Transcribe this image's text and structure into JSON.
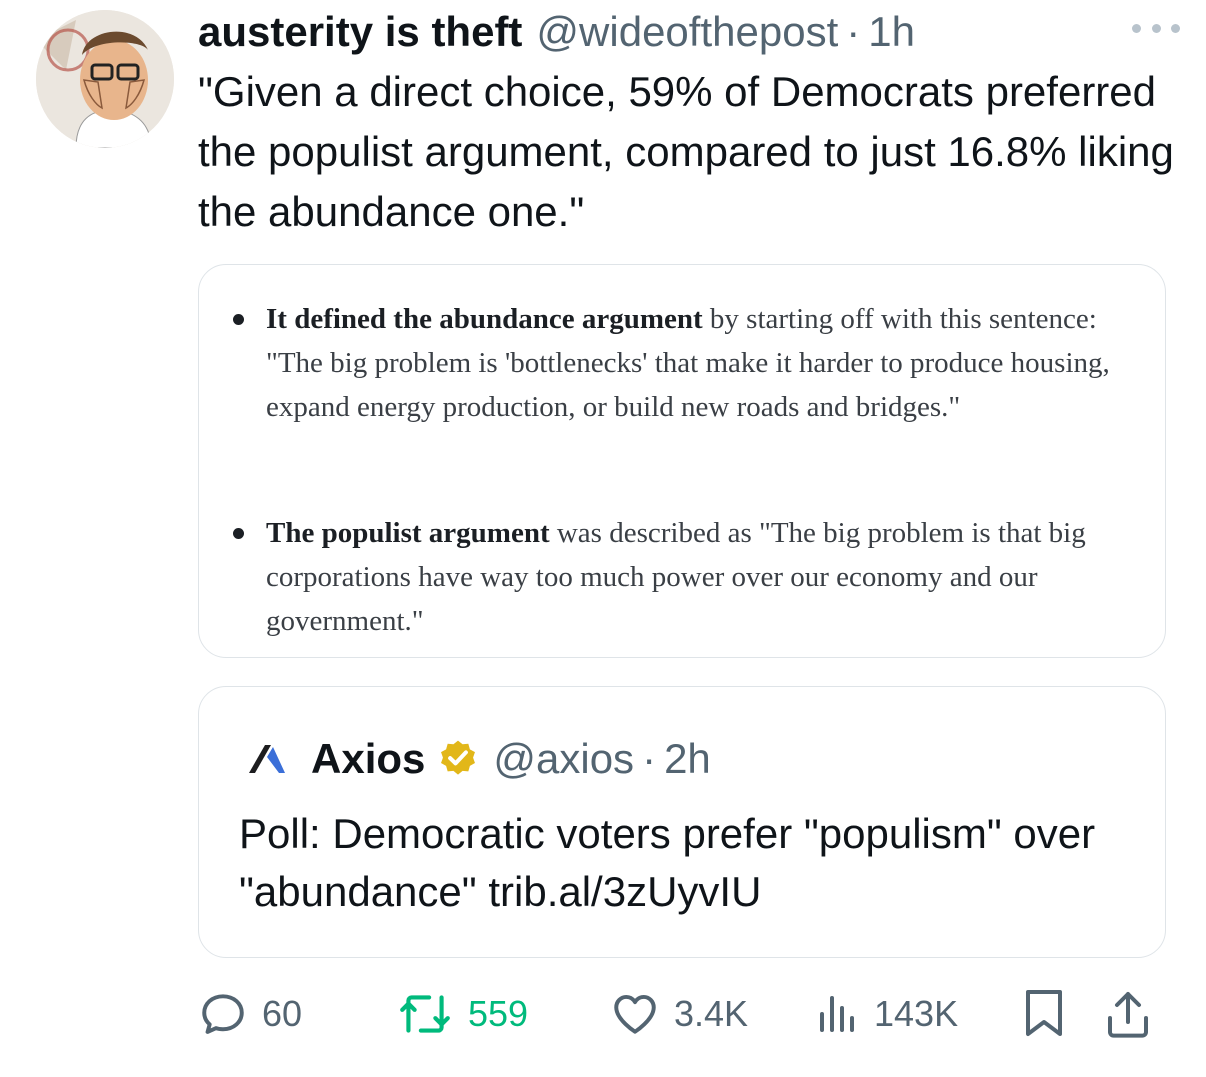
{
  "tweet": {
    "author": {
      "display_name": "austerity is theft",
      "handle": "@wideofthepost",
      "separator": "·",
      "time": "1h",
      "avatar_icon": "cartoon-avatar"
    },
    "text": "\"Given a direct choice, 59% of Democrats preferred the populist argument, compared to just 16.8% liking the abundance one.\"",
    "more_icon": "more-dots-icon",
    "media_card": {
      "bullets": [
        {
          "bold": "It defined the abundance argument",
          "rest": " by starting off with this sentence: \"The big problem is 'bottlenecks' that make it harder to produce housing, expand energy production, or build new roads and bridges.\""
        },
        {
          "bold": "The populist argument",
          "rest": " was described as \"The big problem is that big corporations have way too much power over our economy and our government.\""
        }
      ]
    },
    "quote": {
      "logo_icon": "axios-logo-icon",
      "name": "Axios",
      "verified_icon": "gold-verified-badge-icon",
      "handle": "@axios",
      "separator": "·",
      "time": "2h",
      "text": "Poll: Democratic voters prefer \"populism\" over \"abundance\" trib.al/3zUyvIU"
    },
    "actions": {
      "replies": "60",
      "retweets": "559",
      "likes": "3.4K",
      "views": "143K",
      "icons": [
        "reply-icon",
        "retweet-icon",
        "like-icon",
        "views-icon",
        "bookmark-icon",
        "share-icon"
      ],
      "colors": {
        "muted": "#536471",
        "retweet_active": "#00ba7c"
      }
    }
  }
}
